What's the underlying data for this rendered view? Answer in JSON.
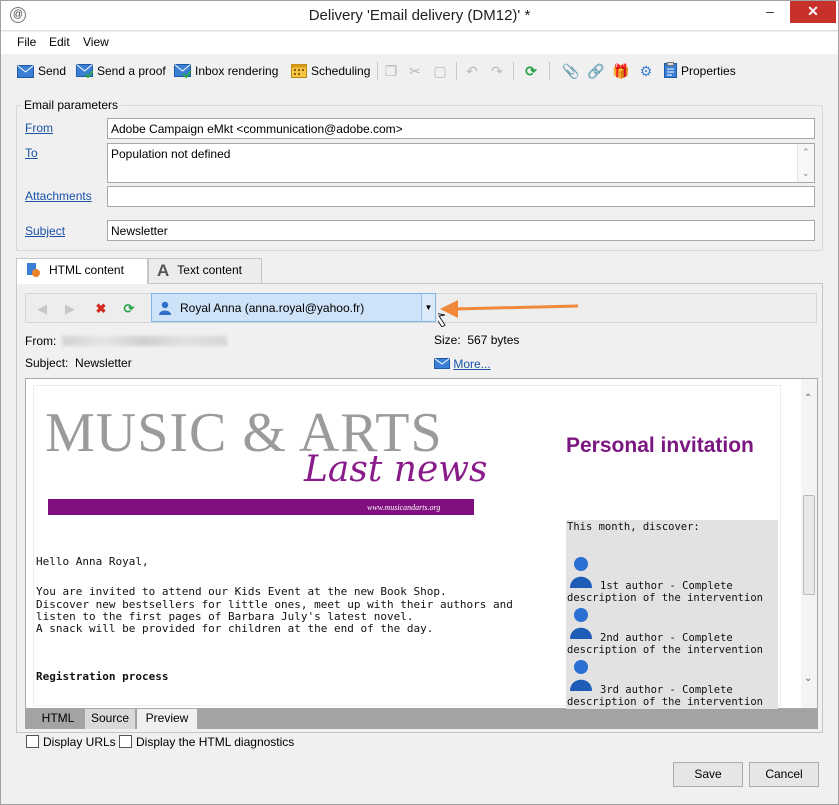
{
  "window": {
    "title": "Delivery 'Email delivery (DM12)' *"
  },
  "menu": [
    "File",
    "Edit",
    "View"
  ],
  "toolbar": {
    "send": "Send",
    "send_proof": "Send a proof",
    "inbox_rendering": "Inbox rendering",
    "scheduling": "Scheduling",
    "properties": "Properties"
  },
  "email_params": {
    "legend": "Email parameters",
    "from_label": "From",
    "from_value": "Adobe Campaign eMkt <communication@adobe.com>",
    "to_label": "To",
    "to_value": "Population not defined",
    "attachments_label": "Attachments",
    "attachments_value": "",
    "subject_label": "Subject",
    "subject_value": "Newsletter"
  },
  "tabs": {
    "html": "HTML content",
    "text": "Text content"
  },
  "preview_bar": {
    "recipient": "Royal Anna (anna.royal@yahoo.fr)"
  },
  "meta": {
    "from_label": "From:",
    "subject_label": "Subject:",
    "subject_value": "Newsletter",
    "size_label": "Size:",
    "size_value": "567 bytes",
    "more": "More..."
  },
  "email": {
    "logo_main": "MUSIC & ARTS",
    "logo_script": "Last news",
    "logo_url": "www.musicandarts.org",
    "invite_title": "Personal invitation",
    "greeting": "Hello Anna Royal,",
    "p1": "You are invited to attend our Kids Event at the new Book Shop.",
    "p2": "Discover new bestsellers for little ones, meet up with their authors and",
    "p3": "listen to the first pages of Barbara July's latest novel.",
    "p4": "A snack will be provided for children at the end of the day.",
    "reg": "Registration process",
    "side_intro": "This month, discover:",
    "authors": [
      {
        "line1": "1st author - Complete",
        "line2": "description of the intervention"
      },
      {
        "line1": "2nd author - Complete",
        "line2": "description of the intervention"
      },
      {
        "line1": "3rd author - Complete",
        "line2": "description of the intervention"
      }
    ]
  },
  "bottom_tabs": {
    "html": "HTML",
    "source": "Source",
    "preview": "Preview"
  },
  "options": {
    "display_urls": "Display URLs",
    "html_diag": "Display the HTML diagnostics"
  },
  "buttons": {
    "save": "Save",
    "cancel": "Cancel"
  },
  "colors": {
    "accent_purple": "#80107f",
    "link_blue": "#1a52a8",
    "close_red": "#c7302b",
    "arrow_orange": "#f0883a"
  }
}
